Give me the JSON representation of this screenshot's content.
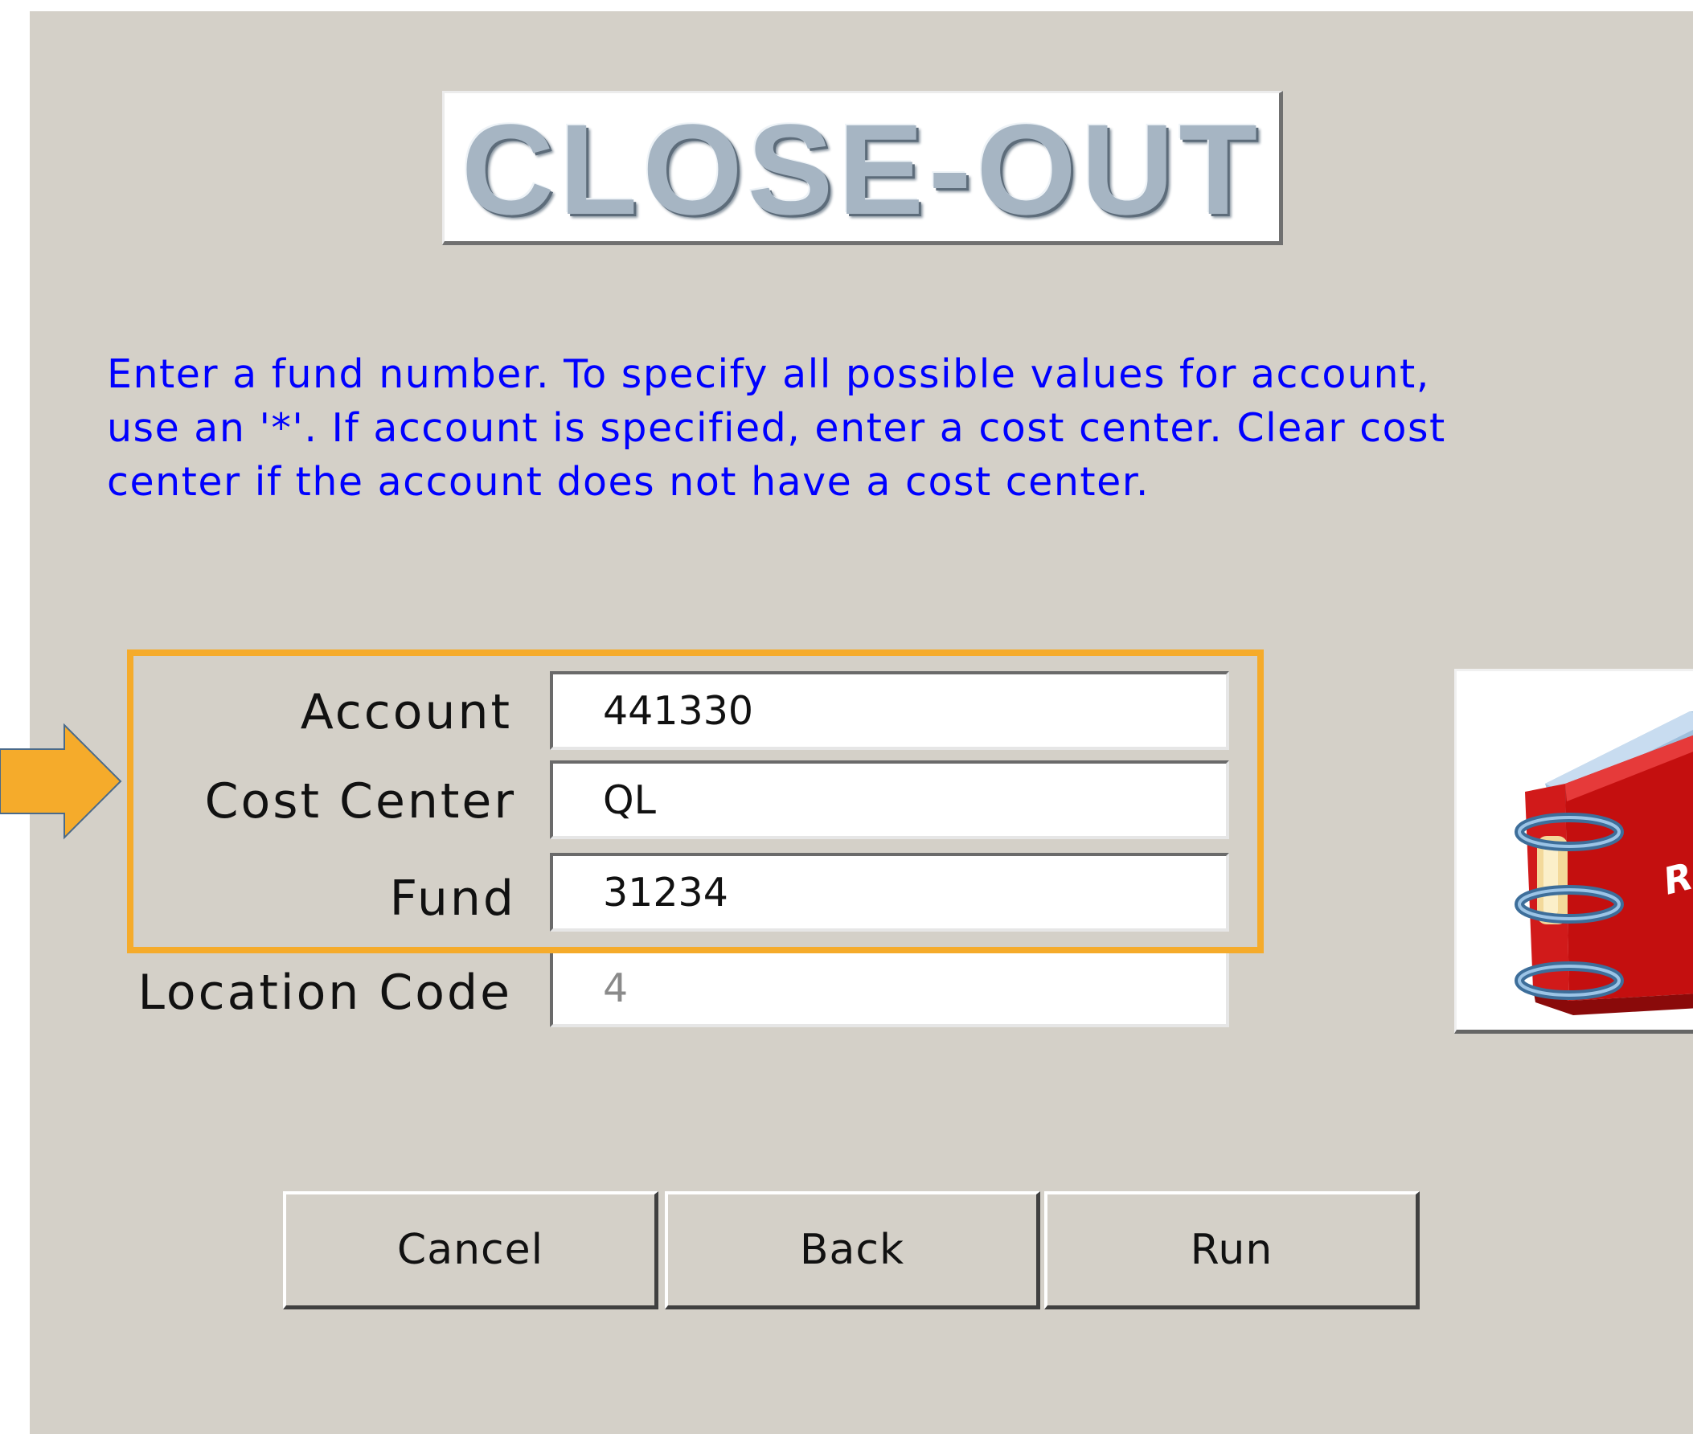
{
  "header": {
    "title": "CLOSE-OUT"
  },
  "instructions": "Enter a fund number.  To specify all possible values for account,\nuse an '*'. If account is specified, enter a cost center. Clear cost\ncenter if the account does not have a cost center.",
  "form": {
    "account": {
      "label": "Account",
      "value": "441330"
    },
    "cost_center": {
      "label": "Cost Center",
      "value": "QL"
    },
    "fund": {
      "label": "Fund",
      "value": "31234"
    },
    "location_code": {
      "label": "Location Code",
      "value": "4"
    }
  },
  "buttons": {
    "cancel": "Cancel",
    "back": "Back",
    "run": "Run"
  },
  "annotation": {
    "highlight_color": "#f5ab2b",
    "arrow_color": "#f5ab2b"
  },
  "report_icon": {
    "visible_text": "RE"
  },
  "colors": {
    "background": "#d4d0c8",
    "instruction_text": "#0000ff"
  }
}
